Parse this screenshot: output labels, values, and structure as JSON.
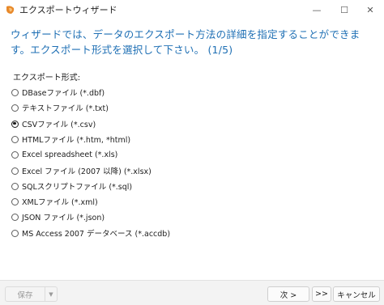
{
  "window": {
    "title": "エクスポートウィザード",
    "minimize_glyph": "—",
    "maximize_glyph": "☐",
    "close_glyph": "✕",
    "icon": "app-orange-icon"
  },
  "heading": "ウィザードでは、データのエクスポート方法の詳細を指定することができます。エクスポート形式を選択して下さい。 (1/5)",
  "format_label": "エクスポート形式:",
  "options": [
    {
      "label": "DBaseファイル (*.dbf)",
      "checked": false
    },
    {
      "label": "テキストファイル (*.txt)",
      "checked": false
    },
    {
      "label": "CSVファイル (*.csv)",
      "checked": true
    },
    {
      "label": "HTMLファイル (*.htm, *html)",
      "checked": false
    },
    {
      "label": "Excel spreadsheet (*.xls)",
      "checked": false
    },
    {
      "label": "Excel ファイル (2007 以降) (*.xlsx)",
      "checked": false
    },
    {
      "label": "SQLスクリプトファイル (*.sql)",
      "checked": false
    },
    {
      "label": "XMLファイル (*.xml)",
      "checked": false
    },
    {
      "label": "JSON ファイル (*.json)",
      "checked": false
    },
    {
      "label": "MS Access 2007 データベース (*.accdb)",
      "checked": false
    }
  ],
  "footer": {
    "save_label": "保存",
    "save_dropdown_glyph": "▼",
    "next_label": "次 >",
    "fast_forward_label": ">>",
    "cancel_label": "キャンセル"
  },
  "colors": {
    "heading": "#1e6fb4",
    "icon": "#e8892a"
  }
}
